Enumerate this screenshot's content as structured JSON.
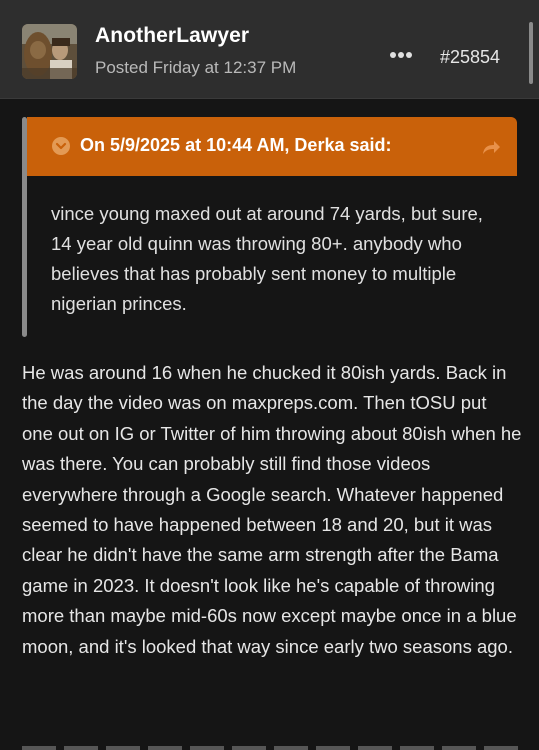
{
  "post": {
    "author": "AnotherLawyer",
    "posted": "Posted Friday at 12:37 PM",
    "number": "#25854",
    "menu_icon": "more-dots-icon"
  },
  "quote": {
    "title": "On 5/9/2025 at 10:44 AM, Derka said:",
    "text": "vince young maxed out at around 74 yards, but sure, 14 year old quinn was throwing 80+. anybody who believes that has probably sent money to multiple nigerian princes.",
    "accent_color": "#c9610a"
  },
  "body": {
    "paragraph": "He was around 16 when he chucked it 80ish yards. Back in the day the video was on maxpreps.com. Then tOSU put one out on IG or Twitter of him throwing about 80ish when he was there. You can probably still find those videos everywhere through a Google search. Whatever happened seemed to have happened between 18 and 20, but it was clear he didn't have the same arm strength after the Bama game in 2023. It doesn't look like he's capable of throwing more than maybe mid-60s now except maybe once in a blue moon, and it's looked that way since early two seasons ago."
  },
  "colors": {
    "background": "#151515",
    "header": "#2e2e2e"
  }
}
